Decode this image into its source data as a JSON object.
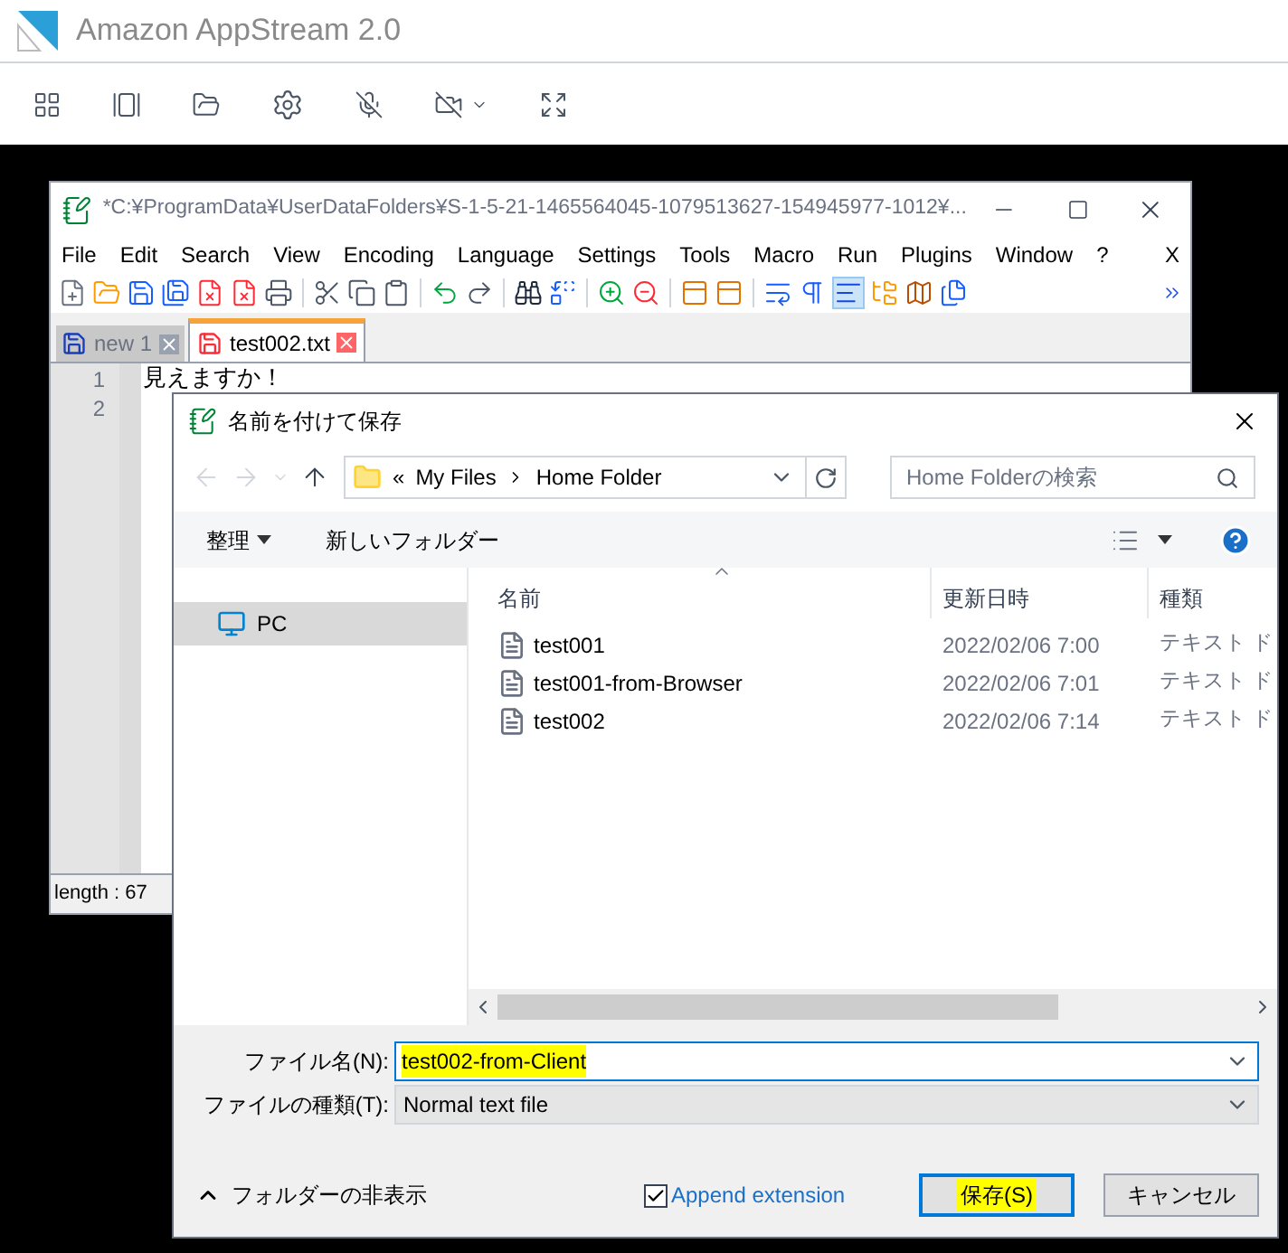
{
  "app": {
    "title": "Amazon AppStream 2.0"
  },
  "editor_window": {
    "title": "*C:¥ProgramData¥UserDataFolders¥S-1-5-21-1465564045-1079513627-154945977-1012¥...",
    "menu": [
      "File",
      "Edit",
      "Search",
      "View",
      "Encoding",
      "Language",
      "Settings",
      "Tools",
      "Macro",
      "Run",
      "Plugins",
      "Window",
      "?"
    ],
    "close_document": "X",
    "tabs": [
      {
        "label": "new 1",
        "selected": false
      },
      {
        "label": "test002.txt",
        "selected": true
      }
    ],
    "lines": [
      {
        "number": "1",
        "text": "見えますか！"
      },
      {
        "number": "2"
      }
    ],
    "status": "length : 67"
  },
  "save_dialog": {
    "title": "名前を付けて保存",
    "breadcrumb": {
      "overflow": "«",
      "parts": [
        "My Files",
        "Home Folder"
      ]
    },
    "search": {
      "placeholder": "Home Folderの検索"
    },
    "commands": {
      "organize": "整理",
      "new_folder": "新しいフォルダー"
    },
    "nav": [
      {
        "label": "PC",
        "selected": true
      }
    ],
    "columns": [
      "名前",
      "更新日時",
      "種類"
    ],
    "files": [
      {
        "name": "test001",
        "date": "2022/02/06 7:00",
        "type": "テキスト ド"
      },
      {
        "name": "test001-from-Browser",
        "date": "2022/02/06 7:01",
        "type": "テキスト ド"
      },
      {
        "name": "test002",
        "date": "2022/02/06 7:14",
        "type": "テキスト ド"
      }
    ],
    "file_name": {
      "label": "ファイル名(N):",
      "value": "test002-from-Client",
      "highlighted": true
    },
    "file_type": {
      "label": "ファイルの種類(T):",
      "value": "Normal text file"
    },
    "hide_folders": "フォルダーの非表示",
    "append_extension": {
      "label": "Append extension",
      "checked": true
    },
    "buttons": [
      {
        "label": "保存(S)",
        "default": true,
        "highlighted": true
      },
      {
        "label": "キャンセル",
        "default": false,
        "highlighted": false
      }
    ]
  }
}
